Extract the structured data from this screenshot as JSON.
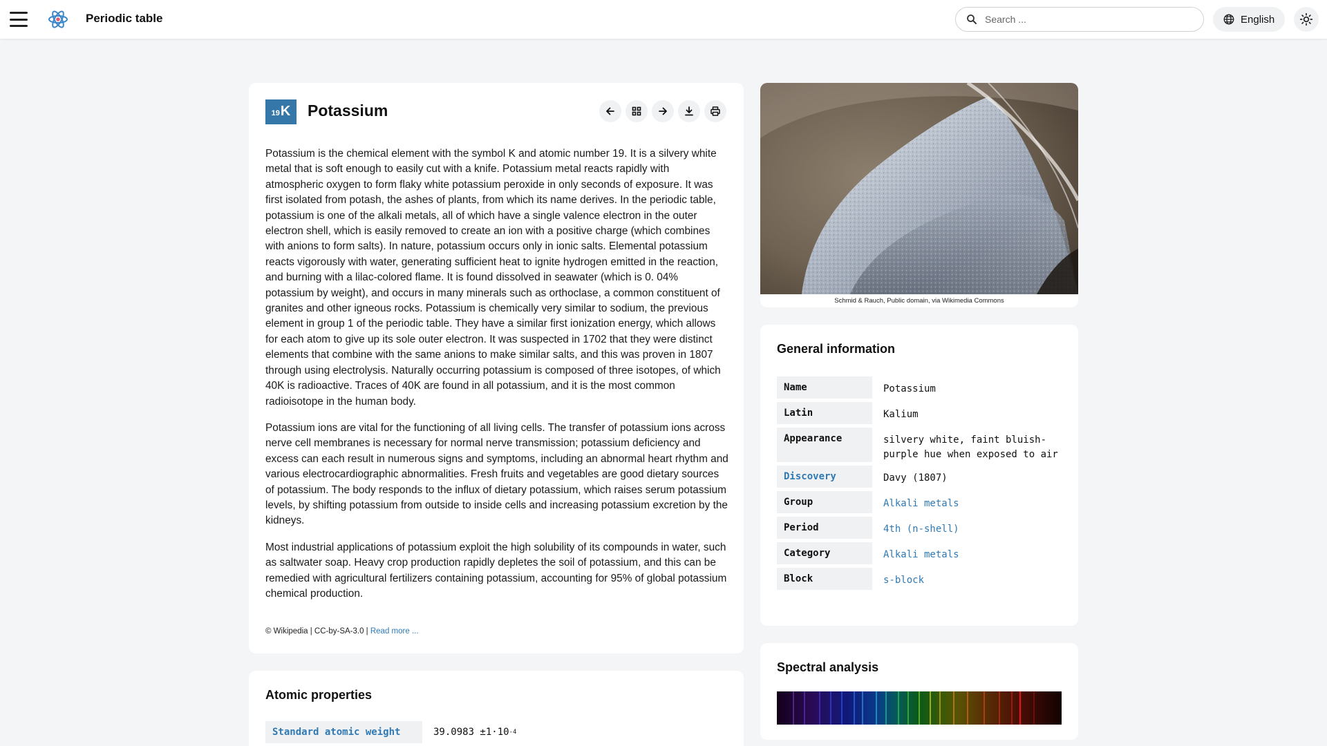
{
  "header": {
    "app_title": "Periodic table",
    "search_placeholder": "Search ...",
    "language": "English"
  },
  "element": {
    "atomic_number": "19",
    "symbol": "K",
    "name": "Potassium",
    "color": "#3477a8"
  },
  "toolbar": {
    "icons": [
      "arrow-left-icon",
      "grid-icon",
      "arrow-right-icon",
      "download-icon",
      "print-icon"
    ]
  },
  "article": {
    "paragraphs": [
      "Potassium is the chemical element with the symbol K and atomic number 19. It is a silvery white metal that is soft enough to easily cut with a knife. Potassium metal reacts rapidly with atmospheric oxygen to form flaky white potassium peroxide in only seconds of exposure. It was first isolated from potash, the ashes of plants, from which its name derives. In the periodic table, potassium is one of the alkali metals, all of which have a single valence electron in the outer electron shell, which is easily removed to create an ion with a positive charge (which combines with anions to form salts). In nature, potassium occurs only in ionic salts. Elemental potassium reacts vigorously with water, generating sufficient heat to ignite hydrogen emitted in the reaction, and burning with a lilac-colored flame. It is found dissolved in seawater (which is 0. 04% potassium by weight), and occurs in many minerals such as orthoclase, a common constituent of granites and other igneous rocks. Potassium is chemically very similar to sodium, the previous element in group 1 of the periodic table. They have a similar first ionization energy, which allows for each atom to give up its sole outer electron. It was suspected in 1702 that they were distinct elements that combine with the same anions to make similar salts, and this was proven in 1807 through using electrolysis. Naturally occurring potassium is composed of three isotopes, of which 40K is radioactive. Traces of 40K are found in all potassium, and it is the most common radioisotope in the human body.",
      "Potassium ions are vital for the functioning of all living cells. The transfer of potassium ions across nerve cell membranes is necessary for normal nerve transmission; potassium deficiency and excess can each result in numerous signs and symptoms, including an abnormal heart rhythm and various electrocardiographic abnormalities. Fresh fruits and vegetables are good dietary sources of potassium. The body responds to the influx of dietary potassium, which raises serum potassium levels, by shifting potassium from outside to inside cells and increasing potassium excretion by the kidneys.",
      "Most industrial applications of potassium exploit the high solubility of its compounds in water, such as saltwater soap. Heavy crop production rapidly depletes the soil of potassium, and this can be remedied with agricultural fertilizers containing potassium, accounting for 95% of global potassium chemical production."
    ],
    "credit": "© Wikipedia | CC-by-SA-3.0 |",
    "read_more": "Read more ..."
  },
  "atomic": {
    "title": "Atomic properties",
    "label": "Standard atomic weight",
    "value": "39.0983 ±1·10",
    "exponent": "-4"
  },
  "image": {
    "caption": "Schmid & Rauch, Public domain, via Wikimedia Commons"
  },
  "info": {
    "title": "General information",
    "rows": [
      {
        "label": "Name",
        "value": "Potassium"
      },
      {
        "label": "Latin",
        "value": "Kalium"
      },
      {
        "label": "Appearance",
        "value": "silvery white, faint bluish-purple hue when exposed to air"
      },
      {
        "label": "Discovery",
        "value": "Davy (1807)"
      },
      {
        "label": "Group",
        "value": "Alkali metals"
      },
      {
        "label": "Period",
        "value": "4th (n-shell)"
      },
      {
        "label": "Category",
        "value": "Alkali metals"
      },
      {
        "label": "Block",
        "value": "s-block"
      }
    ]
  },
  "spectral": {
    "title": "Spectral analysis"
  },
  "colors": {
    "accent": "#2f7ab5",
    "badge": "#3477a8"
  }
}
